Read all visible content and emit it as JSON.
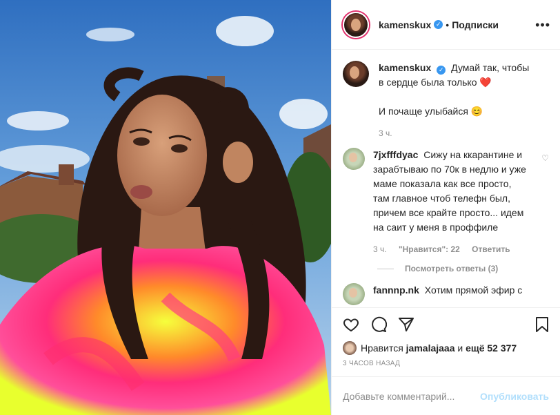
{
  "post": {
    "author": "kamenskux",
    "follow_label": "Подписки",
    "separator": "•",
    "more": "•••"
  },
  "caption": {
    "author": "kamenskux",
    "line1": "Думай так, чтобы в сердце была только",
    "heart": "❤️",
    "line2": "И почаще улыбайся",
    "smile": "😊",
    "time": "3 ч."
  },
  "comments": [
    {
      "author": "7jxfffdyac",
      "text": "Сижу на ккарантине и зарабтываю по 70к в недлю и уже маме показала как все просто, там главное чтоб телефн был, причем все крайте просто... идем на саит у меня в проффиле",
      "time": "3 ч.",
      "likes": "\"Нравится\": 22",
      "reply": "Ответить",
      "view_replies": "Посмотреть ответы (3)"
    },
    {
      "author": "fannnp.nk",
      "text": "Хотим прямой эфир с"
    }
  ],
  "likes": {
    "prefix": "Нравится",
    "user": "jamalajaaa",
    "middle": "и",
    "count": "ещё 52 377"
  },
  "time_ago": "3 ЧАСОВ НАЗАД",
  "add_comment": {
    "placeholder": "Добавьте комментарий...",
    "publish": "Опубликовать"
  },
  "icons": {
    "like": "heart-icon",
    "comment": "comment-icon",
    "share": "share-icon",
    "save": "bookmark-icon",
    "verified": "verified-badge-icon"
  },
  "colors": {
    "verified": "#3897f0",
    "heart": "#ed4956",
    "muted": "#8e8e8e",
    "publish_disabled": "#b2dffc"
  }
}
